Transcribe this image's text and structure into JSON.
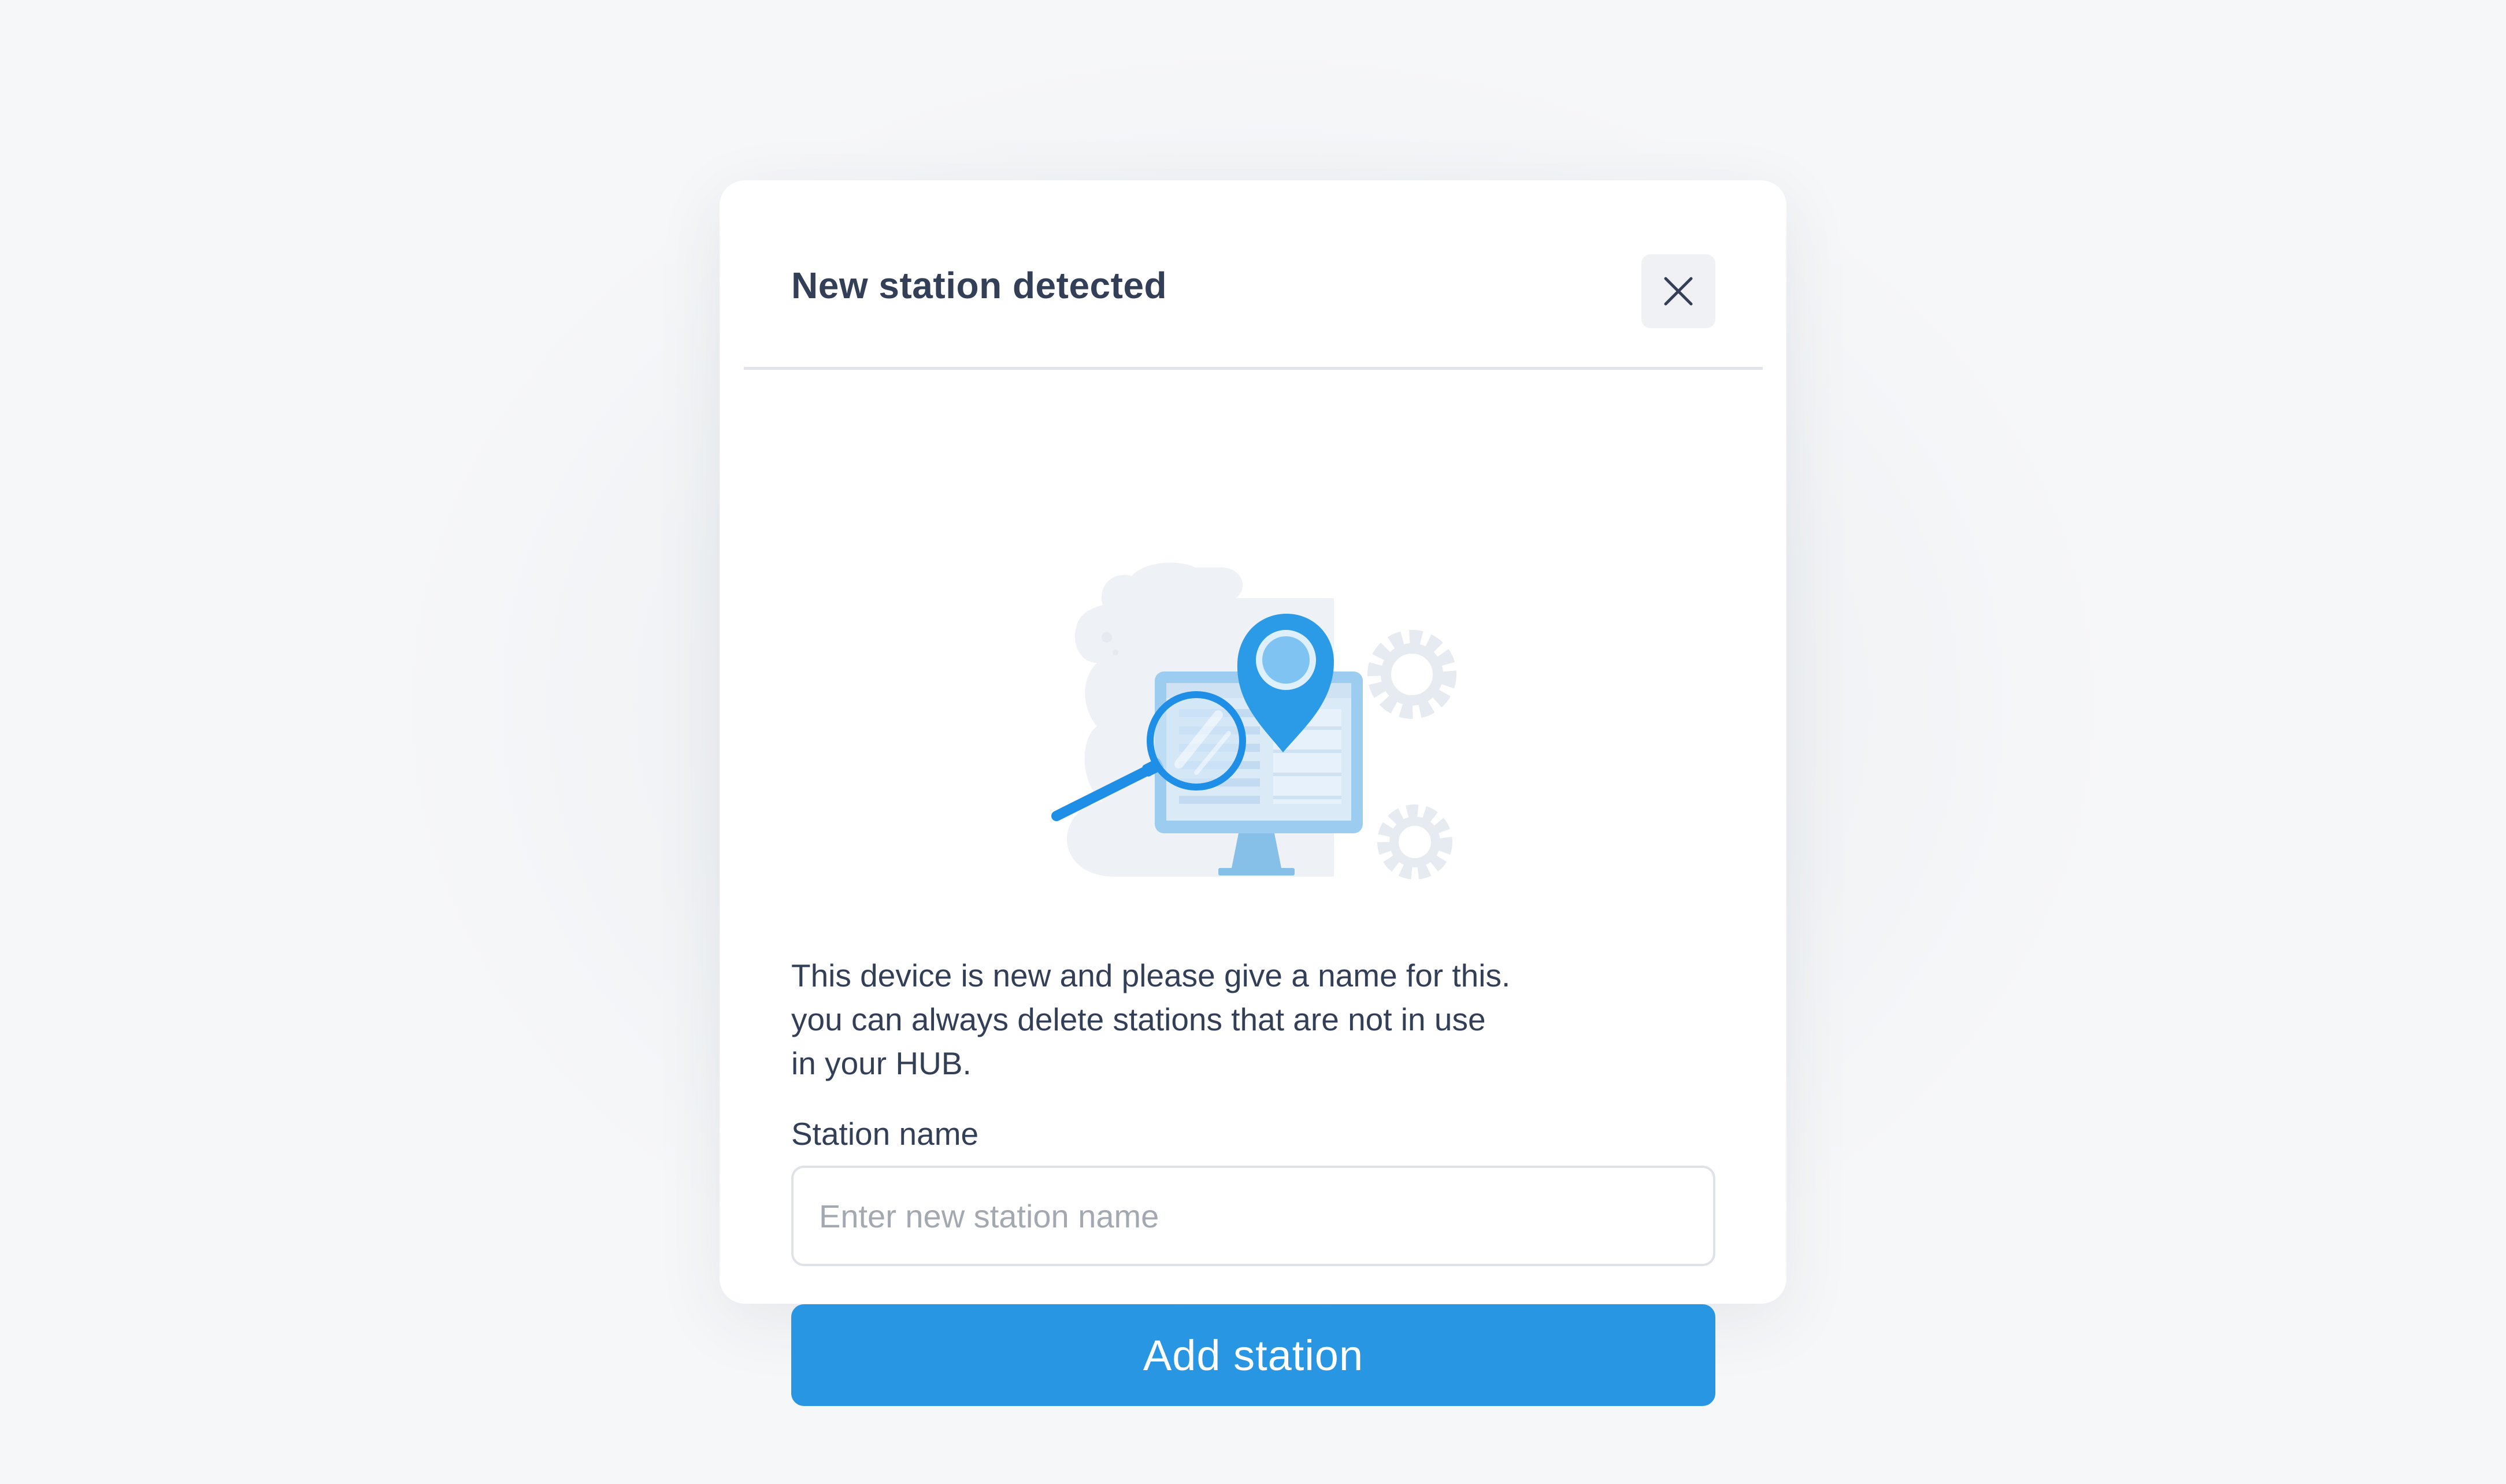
{
  "dialog": {
    "title": "New station detected",
    "close_icon": "close-icon",
    "illustration_icon": "computer-search-location-illustration",
    "description_lines": [
      "This device is new and please give a name for this.",
      "you can always delete stations that are not in use",
      "in your HUB."
    ],
    "field_label": "Station name",
    "input_value": "",
    "input_placeholder": "Enter new station name",
    "submit_label": "Add station"
  },
  "colors": {
    "accent": "#2896e3",
    "title_text": "#333f56",
    "body_text": "#333f56",
    "placeholder_text": "#a3a8b1",
    "close_button_bg": "#eff1f4",
    "input_border": "#dfe2e7",
    "page_background": "#f6f7f9",
    "dialog_background": "#ffffff"
  }
}
